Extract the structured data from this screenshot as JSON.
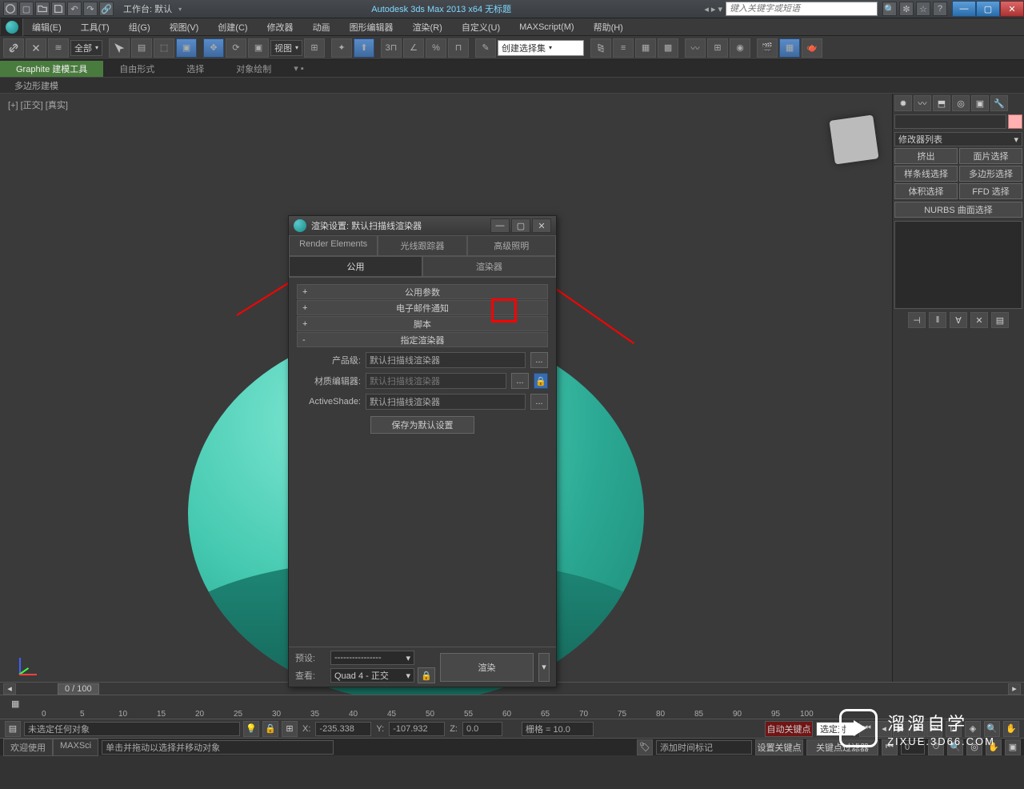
{
  "titlebar": {
    "workspace_label": "工作台: 默认",
    "app_title": "Autodesk 3ds Max  2013 x64   无标题",
    "search_placeholder": "键入关键字或短语"
  },
  "menubar": {
    "items": [
      "编辑(E)",
      "工具(T)",
      "组(G)",
      "视图(V)",
      "创建(C)",
      "修改器",
      "动画",
      "图形编辑器",
      "渲染(R)",
      "自定义(U)",
      "MAXScript(M)",
      "帮助(H)"
    ]
  },
  "toolbar": {
    "sel_dropdown": "全部",
    "view_dropdown": "视图",
    "named_sel": "创建选择集"
  },
  "tabs": {
    "graphite": "Graphite 建模工具",
    "items": [
      "自由形式",
      "选择",
      "对象绘制"
    ],
    "subtab": "多边形建模"
  },
  "viewport_label": "[+] [正交] [真实]",
  "right_panel": {
    "modifier_list": "修改器列表",
    "buttons": [
      "挤出",
      "面片选择",
      "样条线选择",
      "多边形选择",
      "体积选择",
      "FFD 选择"
    ],
    "nurbs": "NURBS 曲面选择"
  },
  "render_dialog": {
    "title": "渲染设置: 默认扫描线渲染器",
    "tabs_row1": [
      "Render Elements",
      "光线跟踪器",
      "高级照明"
    ],
    "tabs_row2": [
      "公用",
      "渲染器"
    ],
    "sections": [
      "公用参数",
      "电子邮件通知",
      "脚本",
      "指定渲染器"
    ],
    "renderer_rows": {
      "prod_label": "产品级:",
      "prod_value": "默认扫描线渲染器",
      "mat_label": "材质编辑器:",
      "mat_value": "默认扫描线渲染器",
      "as_label": "ActiveShade:",
      "as_value": "默认扫描线渲染器"
    },
    "save_default": "保存为默认设置",
    "footer": {
      "preset_label": "预设:",
      "preset_value": "----------------",
      "view_label": "查看:",
      "view_value": "Quad 4 - 正交",
      "render_btn": "渲染"
    }
  },
  "timeline": {
    "frame": "0 / 100",
    "ticks": [
      "0",
      "5",
      "10",
      "15",
      "20",
      "25",
      "30",
      "35",
      "40",
      "45",
      "50",
      "55",
      "60",
      "65",
      "70",
      "75",
      "80",
      "85",
      "90",
      "95",
      "100"
    ]
  },
  "status": {
    "selection": "未选定任何对象",
    "hint": "单击并拖动以选择并移动对象",
    "x_label": "X:",
    "x_val": "-235.338",
    "y_label": "Y:",
    "y_val": "-107.932",
    "z_label": "Z:",
    "z_val": "0.0",
    "grid_label": "栅格 = 10.0",
    "autokey": "自动关键点",
    "sel_set": "选定对",
    "addtime": "添加时间标记",
    "setkey": "设置关键点",
    "keyfilter": "关键点过滤器",
    "frame_num": "0"
  },
  "welcome": {
    "tab1": "欢迎使用",
    "tab2": "MAXSci"
  },
  "watermark": {
    "title": "溜溜自学",
    "url": "ZIXUE.3D66.COM"
  }
}
